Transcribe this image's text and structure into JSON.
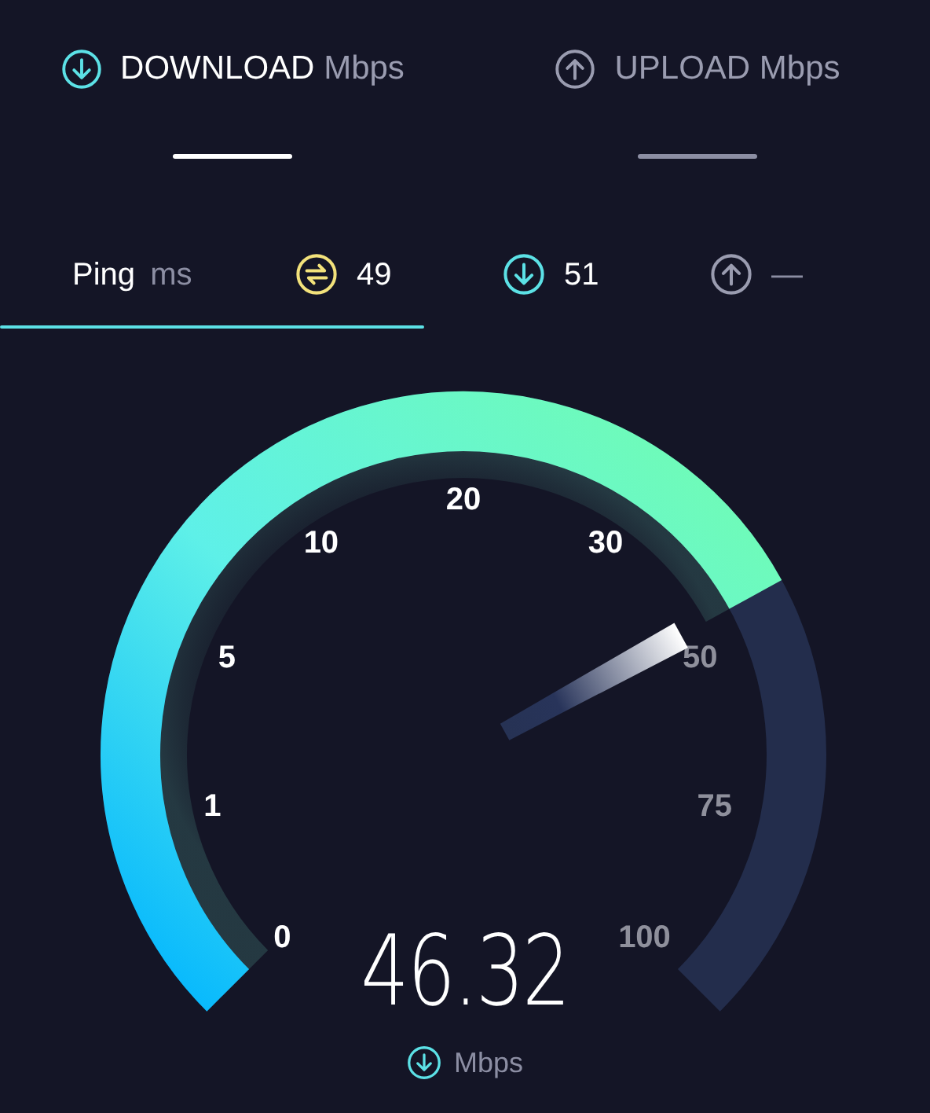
{
  "tabs": [
    {
      "kind": "download",
      "label": "DOWNLOAD",
      "unit": "Mbps",
      "selected": true
    },
    {
      "kind": "upload",
      "label": "UPLOAD",
      "unit": "Mbps",
      "selected": false
    }
  ],
  "ping": {
    "label": "Ping",
    "unit": "ms",
    "readings": [
      {
        "kind": "ping",
        "value": "49"
      },
      {
        "kind": "download",
        "value": "51"
      },
      {
        "kind": "upload",
        "value": "—"
      }
    ]
  },
  "gauge": {
    "scale": [
      "0",
      "1",
      "5",
      "10",
      "20",
      "30",
      "50",
      "75",
      "100"
    ],
    "value": "46.32",
    "unit": "Mbps"
  }
}
